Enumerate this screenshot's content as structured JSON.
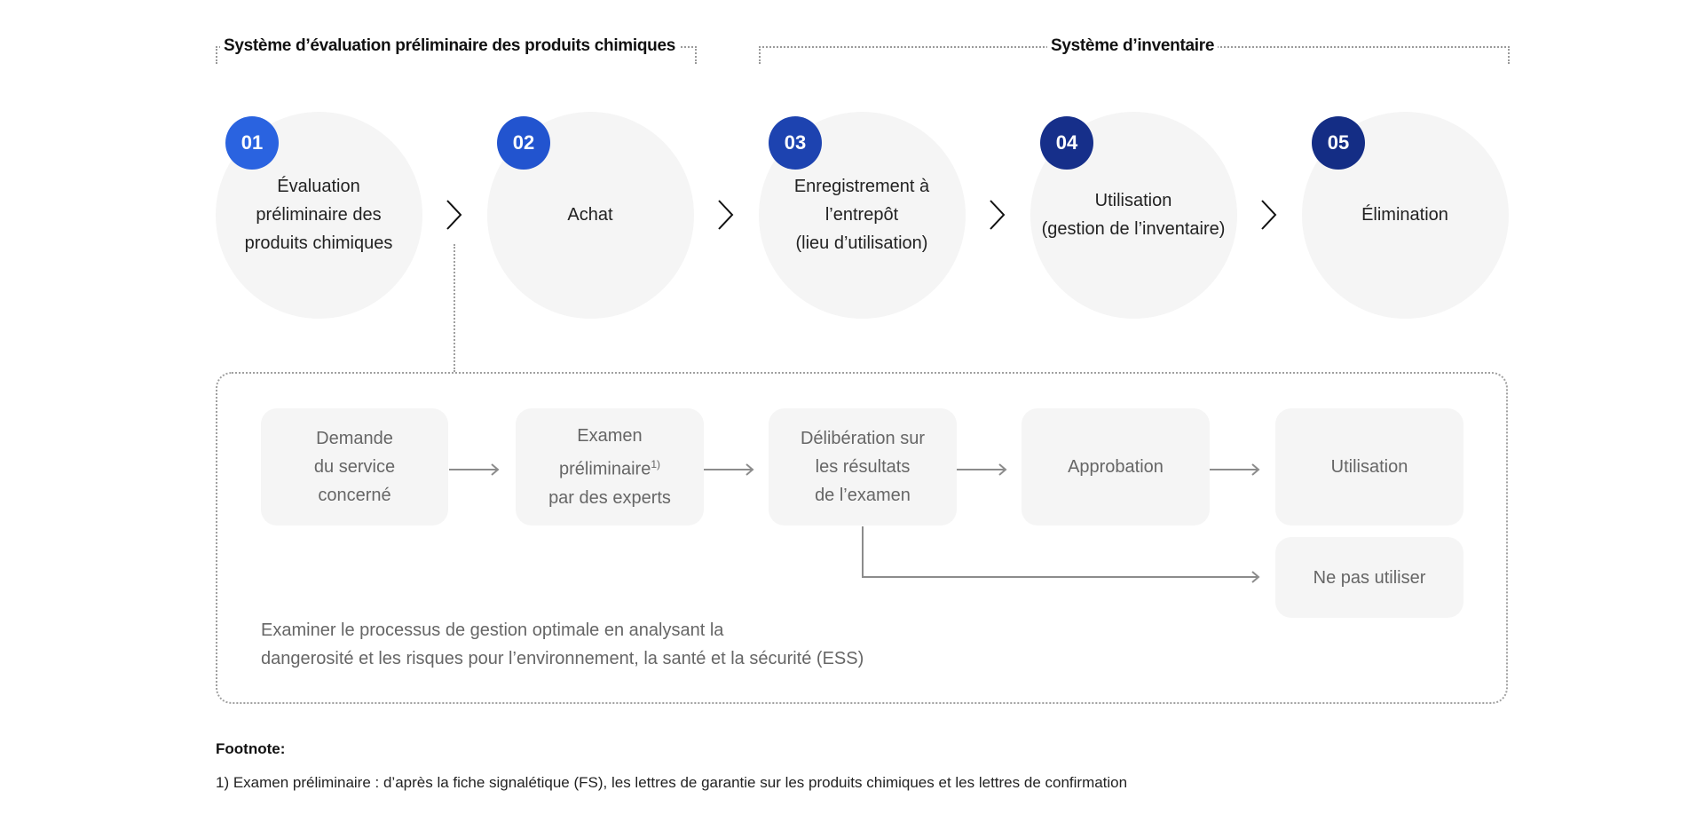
{
  "headers": {
    "left": "Système d’évaluation préliminaire des produits chimiques",
    "right": "Système d’inventaire"
  },
  "steps": [
    {
      "number": "01",
      "label": "Évaluation\npréliminaire des\nproduits chimiques",
      "color": "#2a63e0"
    },
    {
      "number": "02",
      "label": "Achat",
      "color": "#2254cf"
    },
    {
      "number": "03",
      "label": "Enregistrement à\nl’entrepôt\n(lieu d’utilisation)",
      "color": "#1d43b0"
    },
    {
      "number": "04",
      "label": "Utilisation\n(gestion de l’inventaire)",
      "color": "#162f8a"
    },
    {
      "number": "05",
      "label": "Élimination",
      "color": "#142d85"
    }
  ],
  "process": {
    "boxes": [
      {
        "label": "Demande\ndu service\nconcerné"
      },
      {
        "label": "Examen\npréliminaire",
        "sup": "1)",
        "label_after": "par des experts"
      },
      {
        "label": "Délibération sur\nles résultats\nde l’examen"
      },
      {
        "label": "Approbation"
      },
      {
        "label": "Utilisation"
      },
      {
        "label": "Ne pas utiliser"
      }
    ],
    "description_line1": "Examiner le processus de gestion optimale en analysant la",
    "description_line2": "dangerosité et les risques pour l’environnement, la santé et la sécurité (ESS)"
  },
  "footnote": {
    "title": "Footnote:",
    "text": "1) Examen préliminaire : d’après la fiche signalétique (FS), les lettres de garantie sur les produits chimiques et les lettres de confirmation"
  },
  "colors": {
    "circle_bg": "#f5f5f5",
    "box_bg": "#f5f5f5",
    "arrow": "#8c8c8c",
    "dotted": "#a0a0a0"
  }
}
